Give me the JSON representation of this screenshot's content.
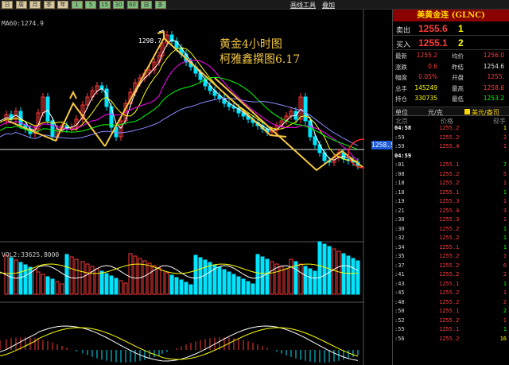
{
  "toolbar": {
    "buttons": [
      "日",
      "周",
      "月",
      "季",
      "年",
      "1",
      "5",
      "15",
      "30",
      "60",
      "自",
      "多"
    ],
    "link1": "画线工具",
    "link2": "叠加"
  },
  "chart": {
    "ma_label": "MA60:1274.9",
    "vol_label": "VOL2:33625.8000",
    "annotation_title": "黄金4小时图",
    "annotation_author": "柯雅鑫撰图6.17",
    "peak_label": "1298.7",
    "price_tag": "1258.5",
    "colors": {
      "up": "#ff3a3a",
      "down": "#00e5ff",
      "annot": "#f5c842",
      "ma1": "#ffffff",
      "ma2": "#ffff00",
      "ma3": "#ff00ff",
      "ma4": "#00ff00",
      "ma5": "#8a8aff"
    }
  },
  "panel": {
    "title": "美黄金连 (GLNC)",
    "sell_label": "卖出",
    "sell_price": "1255.6",
    "sell_qty": "1",
    "buy_label": "买入",
    "buy_price": "1255.1",
    "buy_qty": "2",
    "quote": [
      {
        "l": "最新",
        "v": "1255.2",
        "c": "#ff3a3a",
        "l2": "均价",
        "v2": "1256.0",
        "c2": "#ff3a3a"
      },
      {
        "l": "涨跌",
        "v": "0.6",
        "c": "#ff3a3a",
        "l2": "昨结",
        "v2": "1254.6",
        "c2": "#e0e0e0"
      },
      {
        "l": "幅度",
        "v": "0.05%",
        "c": "#ff3a3a",
        "l2": "开盘",
        "v2": "1255.",
        "c2": "#ff3a3a"
      },
      {
        "l": "总手",
        "v": "145249",
        "c": "#ffff00",
        "l2": "最高",
        "v2": "1258.6",
        "c2": "#ff3a3a"
      },
      {
        "l": "持仓",
        "v": "330735",
        "c": "#ffff00",
        "l2": "最低",
        "v2": "1253.2",
        "c2": "#00ff00"
      }
    ],
    "tick_header_unit": "单位",
    "tick_header_currency": "元/克",
    "tick_header_alt": "美元/盎司",
    "col_location": "北京",
    "col_price": "价格",
    "col_vol": "现手",
    "ticks": [
      {
        "t": "04:58",
        "p": "1255.2",
        "v": "1",
        "vc": "#ffff00",
        "bold": true
      },
      {
        "t": ":59",
        "p": "1255.2",
        "v": "2",
        "vc": "#ff3a3a"
      },
      {
        "t": ":59",
        "p": "1255.4",
        "v": "1",
        "vc": "#ff3a3a"
      },
      {
        "t": "04:59",
        "p": "",
        "v": "",
        "vc": "#ffff00",
        "bold": true
      },
      {
        "t": ":01",
        "p": "1255.1",
        "v": "7",
        "vc": "#00ff00"
      },
      {
        "t": ":08",
        "p": "1255.2",
        "v": "5",
        "vc": "#ff3a3a"
      },
      {
        "t": ":18",
        "p": "1255.2",
        "v": "1",
        "vc": "#ff3a3a"
      },
      {
        "t": ":18",
        "p": "1255.1",
        "v": "1",
        "vc": "#00ff00"
      },
      {
        "t": ":19",
        "p": "1255.3",
        "v": "1",
        "vc": "#ff3a3a"
      },
      {
        "t": ":21",
        "p": "1255.4",
        "v": "3",
        "vc": "#ff3a3a"
      },
      {
        "t": ":30",
        "p": "1255.3",
        "v": "1",
        "vc": "#ff3a3a"
      },
      {
        "t": ":30",
        "p": "1255.2",
        "v": "1",
        "vc": "#00ff00"
      },
      {
        "t": ":32",
        "p": "1255.2",
        "v": "1",
        "vc": "#00ff00"
      },
      {
        "t": ":34",
        "p": "1255.1",
        "v": "1",
        "vc": "#00ff00"
      },
      {
        "t": ":35",
        "p": "1255.2",
        "v": "1",
        "vc": "#ff3a3a"
      },
      {
        "t": ":37",
        "p": "1255.2",
        "v": "6",
        "vc": "#ff3a3a"
      },
      {
        "t": ":41",
        "p": "1255.2",
        "v": "2",
        "vc": "#ff3a3a"
      },
      {
        "t": ":43",
        "p": "1255.1",
        "v": "1",
        "vc": "#00ff00"
      },
      {
        "t": ":45",
        "p": "1255.2",
        "v": "1",
        "vc": "#ff3a3a"
      },
      {
        "t": ":48",
        "p": "1255.2",
        "v": "2",
        "vc": "#ff3a3a"
      },
      {
        "t": ":50",
        "p": "1255.1",
        "v": "2",
        "vc": "#00ff00"
      },
      {
        "t": ":52",
        "p": "1255.2",
        "v": "1",
        "vc": "#ff3a3a"
      },
      {
        "t": ":55",
        "p": "1255.1",
        "v": "1",
        "vc": "#00ff00"
      },
      {
        "t": ":56",
        "p": "1255.2",
        "v": "16",
        "vc": "#ffff00"
      }
    ]
  }
}
